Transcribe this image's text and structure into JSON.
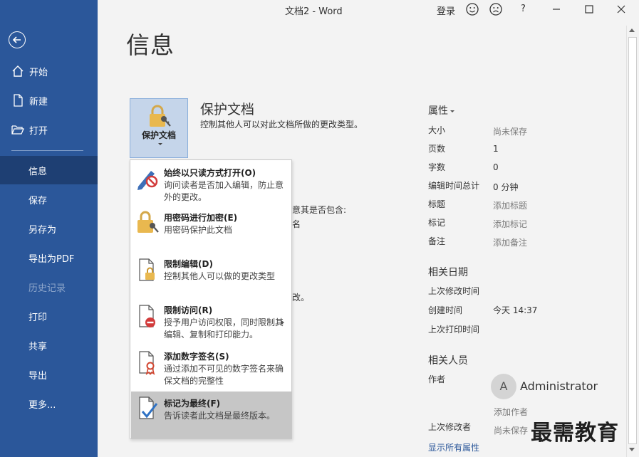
{
  "window": {
    "title": "文档2 - Word",
    "login_label": "登录",
    "help_label": "?"
  },
  "sidebar": {
    "items": [
      {
        "label": "开始",
        "icon": "home-icon"
      },
      {
        "label": "新建",
        "icon": "new-doc-icon"
      },
      {
        "label": "打开",
        "icon": "folder-open-icon"
      },
      {
        "label": "信息",
        "active": true
      },
      {
        "label": "保存"
      },
      {
        "label": "另存为"
      },
      {
        "label": "导出为PDF"
      },
      {
        "label": "历史记录",
        "disabled": true
      },
      {
        "label": "打印"
      },
      {
        "label": "共享"
      },
      {
        "label": "导出"
      },
      {
        "label": "更多..."
      }
    ]
  },
  "main": {
    "page_title": "信息",
    "protect": {
      "tile_label": "保护文档",
      "title": "保护文档",
      "description": "控制其他人可以对此文档所做的更改类型。"
    },
    "background_fragments": [
      "意其是否包含:",
      "名",
      "改。"
    ]
  },
  "protect_menu": {
    "items": [
      {
        "title": "始终以只读方式打开(O)",
        "desc": "询问读者是否加入编辑，防止意外的更改。",
        "icon": "pen-no-edit-icon"
      },
      {
        "title": "用密码进行加密(E)",
        "desc": "用密码保护此文档",
        "icon": "lock-key-icon"
      },
      {
        "title": "限制编辑(D)",
        "desc": "控制其他人可以做的更改类型",
        "icon": "doc-lock-icon"
      },
      {
        "title": "限制访问(R)",
        "desc": "授予用户访问权限，同时限制其编辑、复制和打印能力。",
        "icon": "doc-restricted-icon",
        "submenu": true
      },
      {
        "title": "添加数字签名(S)",
        "desc": "通过添加不可见的数字签名来确保文档的完整性",
        "icon": "doc-ribbon-icon"
      },
      {
        "title": "标记为最终(F)",
        "desc": "告诉读者此文档是最终版本。",
        "icon": "doc-check-icon",
        "highlighted": true
      }
    ]
  },
  "properties": {
    "header": "属性",
    "rows": [
      {
        "label": "大小",
        "value": "尚未保存",
        "muted": true
      },
      {
        "label": "页数",
        "value": "1"
      },
      {
        "label": "字数",
        "value": "0"
      },
      {
        "label": "编辑时间总计",
        "value": "0 分钟"
      },
      {
        "label": "标题",
        "value": "添加标题",
        "muted": true
      },
      {
        "label": "标记",
        "value": "添加标记",
        "muted": true
      },
      {
        "label": "备注",
        "value": "添加备注",
        "muted": true
      }
    ],
    "dates_header": "相关日期",
    "dates": [
      {
        "label": "上次修改时间",
        "value": ""
      },
      {
        "label": "创建时间",
        "value": "今天 14:37"
      },
      {
        "label": "上次打印时间",
        "value": ""
      }
    ],
    "people_header": "相关人员",
    "author_label": "作者",
    "author_initial": "A",
    "author_name": "Administrator",
    "add_author": "添加作者",
    "last_modified_by_label": "上次修改者",
    "last_modified_by_value": "尚未保存",
    "show_all": "显示所有属性"
  },
  "watermark": "最需教育",
  "colors": {
    "sidebar": "#2b579a",
    "sidebar_active": "#1e3f73",
    "background": "#f3f3f3",
    "tile": "#c5d5ea",
    "menu_highlight": "#c6c6c6"
  }
}
